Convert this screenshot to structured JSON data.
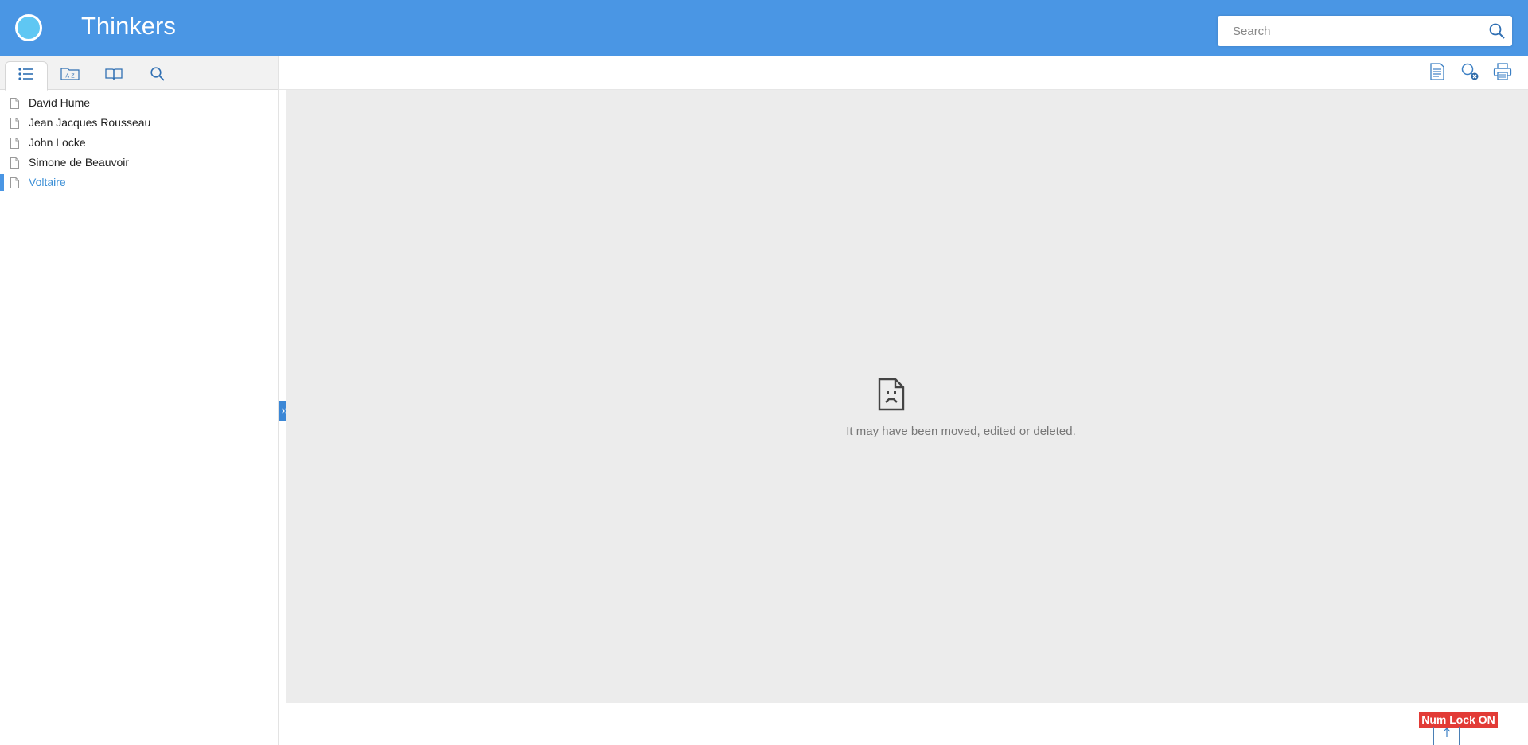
{
  "header": {
    "logo_icon": "circle-logo-icon",
    "title": "Thinkers",
    "search": {
      "placeholder": "Search",
      "value": "",
      "icon": "search-icon"
    }
  },
  "sidebar": {
    "tabs": [
      {
        "name": "contents",
        "icon": "list-icon",
        "active": true
      },
      {
        "name": "index",
        "icon": "a-z-icon",
        "active": false
      },
      {
        "name": "glossary",
        "icon": "book-icon",
        "active": false
      },
      {
        "name": "search",
        "icon": "search-icon",
        "active": false
      }
    ],
    "items": [
      {
        "label": "David Hume",
        "icon": "document-icon",
        "selected": false
      },
      {
        "label": "Jean Jacques Rousseau",
        "icon": "document-icon",
        "selected": false
      },
      {
        "label": "John Locke",
        "icon": "document-icon",
        "selected": false
      },
      {
        "label": "Simone de Beauvoir",
        "icon": "document-icon",
        "selected": false
      },
      {
        "label": "Voltaire",
        "icon": "document-icon",
        "selected": true
      }
    ],
    "toggle_icon": "double-chevron-right-icon"
  },
  "toolbar": {
    "buttons": [
      {
        "name": "topic-doc",
        "icon": "document-text-icon"
      },
      {
        "name": "clear-highlights",
        "icon": "clear-search-icon"
      },
      {
        "name": "print",
        "icon": "print-icon"
      }
    ]
  },
  "content": {
    "icon": "broken-document-icon",
    "message": "It may have been moved, edited or deleted."
  },
  "status": {
    "numlock": "Num Lock ON",
    "scroll_top_icon": "arrow-up-icon"
  },
  "colors": {
    "header_bg": "#4a96e4",
    "accent": "#3c8fd6",
    "content_bg": "#ececec",
    "numlock_bg": "#e23b36"
  }
}
